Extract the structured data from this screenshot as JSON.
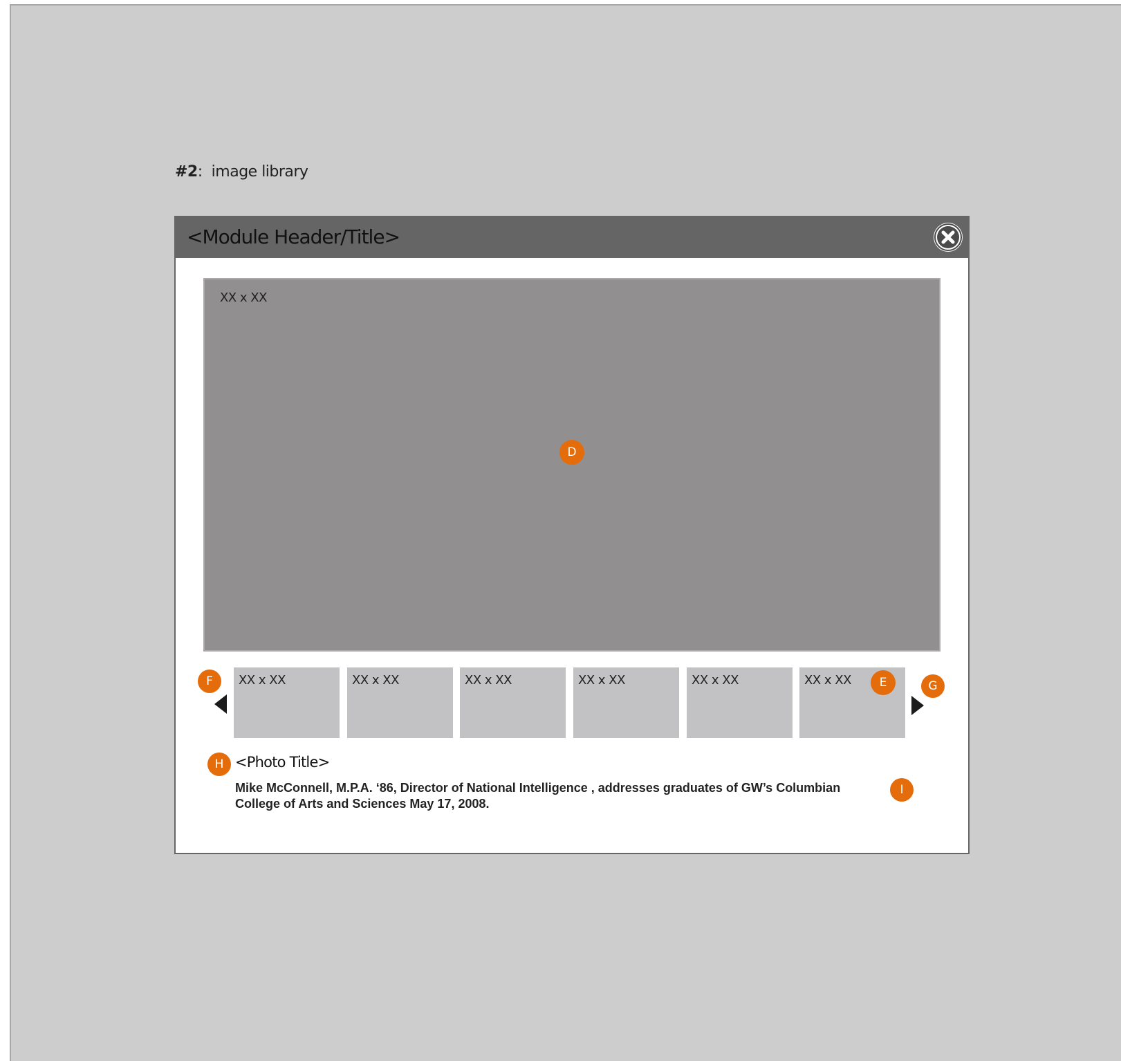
{
  "page_label": {
    "number": "#2",
    "separator": ":",
    "text": "image library"
  },
  "module": {
    "title": "<Module Header/Title>",
    "main_image": {
      "dimensions": "XX x XX",
      "badge": "D"
    },
    "thumbnails": [
      {
        "dimensions": "XX x XX"
      },
      {
        "dimensions": "XX x XX"
      },
      {
        "dimensions": "XX x XX"
      },
      {
        "dimensions": "XX x XX"
      },
      {
        "dimensions": "XX x XX"
      },
      {
        "dimensions": "XX x XX"
      }
    ],
    "thumb_badge": "E",
    "prev_badge": "F",
    "next_badge": "G",
    "photo_title_badge": "H",
    "photo_title": "<Photo Title>",
    "caption_badge": "I",
    "caption_line1": "Mike McConnell, M.P.A. ‘86, Director of National Intelligence , addresses graduates of GW’s Columbian",
    "caption_line2": "College of Arts and Sciences May 17, 2008."
  },
  "colors": {
    "background": "#cdcdcd",
    "header": "#656566",
    "main_image": "#918f90",
    "thumbnail": "#c2c2c4",
    "badge": "#e46c0a"
  },
  "icons": {
    "close": "close-circle-icon",
    "prev": "triangle-left-icon",
    "next": "triangle-right-icon"
  }
}
